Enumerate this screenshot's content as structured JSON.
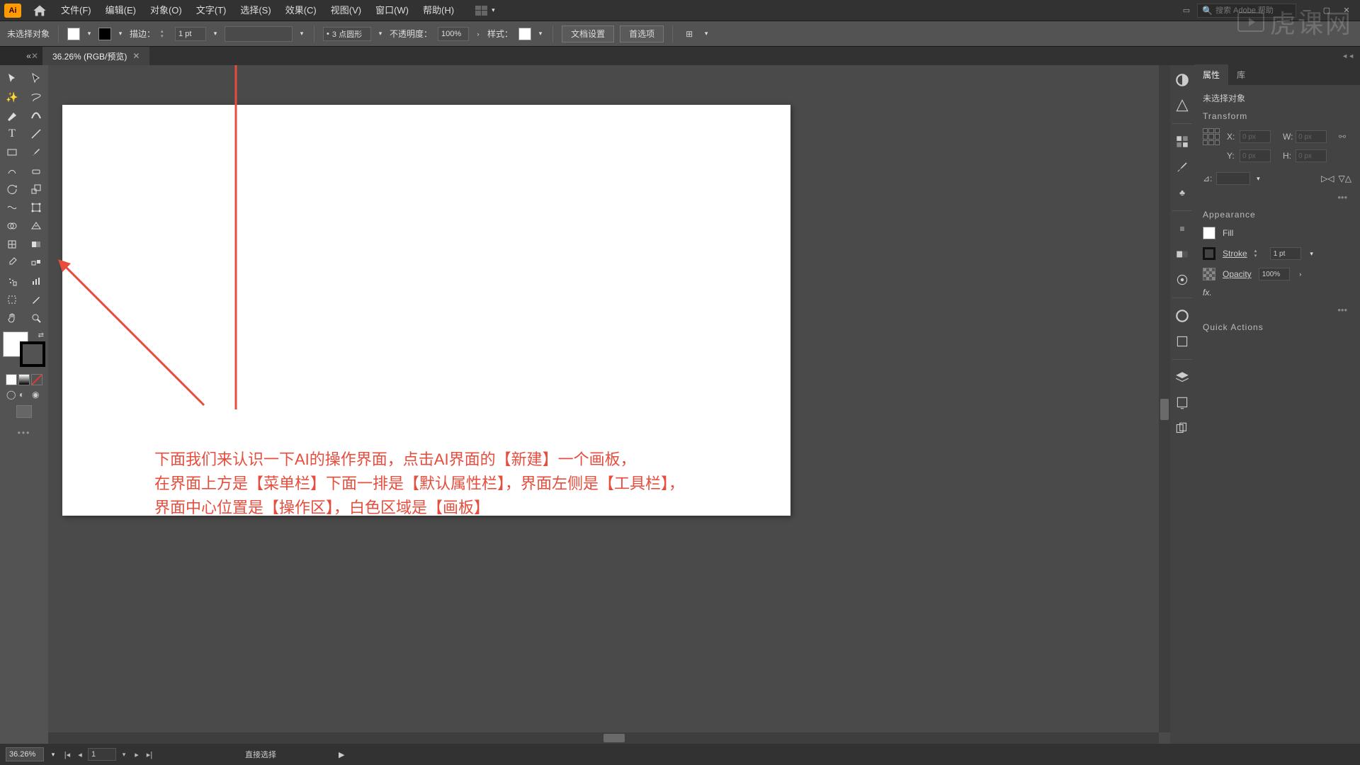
{
  "app": {
    "id": "Ai"
  },
  "menubar": {
    "items": [
      "文件(F)",
      "编辑(E)",
      "对象(O)",
      "文字(T)",
      "选择(S)",
      "效果(C)",
      "视图(V)",
      "窗口(W)",
      "帮助(H)"
    ],
    "search_placeholder": "搜索 Adobe 帮助"
  },
  "controlbar": {
    "no_selection": "未选择对象",
    "stroke_label": "描边：",
    "stroke_value": "1 pt",
    "profile_label": "3 点圆形",
    "opacity_label": "不透明度：",
    "opacity_value": "100%",
    "style_label": "样式：",
    "doc_setup": "文档设置",
    "preferences": "首选项"
  },
  "document": {
    "tab_title": "36.26% (RGB/预览)"
  },
  "annotations": {
    "line1": "下面我们来认识一下AI的操作界面，点击AI界面的【新建】一个画板，",
    "line2": "在界面上方是【菜单栏】下面一排是【默认属性栏】，界面左侧是【工具栏】，",
    "line3": "界面中心位置是【操作区】，白色区域是【画板】"
  },
  "panel": {
    "tabs": {
      "properties": "属性",
      "libraries": "库"
    },
    "no_selection": "未选择对象",
    "transform": {
      "title": "Transform",
      "x": "X:",
      "y": "Y:",
      "w": "W:",
      "h": "H:",
      "xv": "0 px",
      "yv": "0 px",
      "wv": "0 px",
      "hv": "0 px",
      "angle": "⊿:"
    },
    "appearance": {
      "title": "Appearance",
      "fill": "Fill",
      "stroke": "Stroke",
      "stroke_value": "1 pt",
      "opacity": "Opacity",
      "opacity_value": "100%",
      "fx": "fx."
    },
    "quick_actions": "Quick Actions"
  },
  "statusbar": {
    "zoom": "36.26%",
    "artboard": "1",
    "tool": "直接选择"
  },
  "watermark": "虎课网"
}
